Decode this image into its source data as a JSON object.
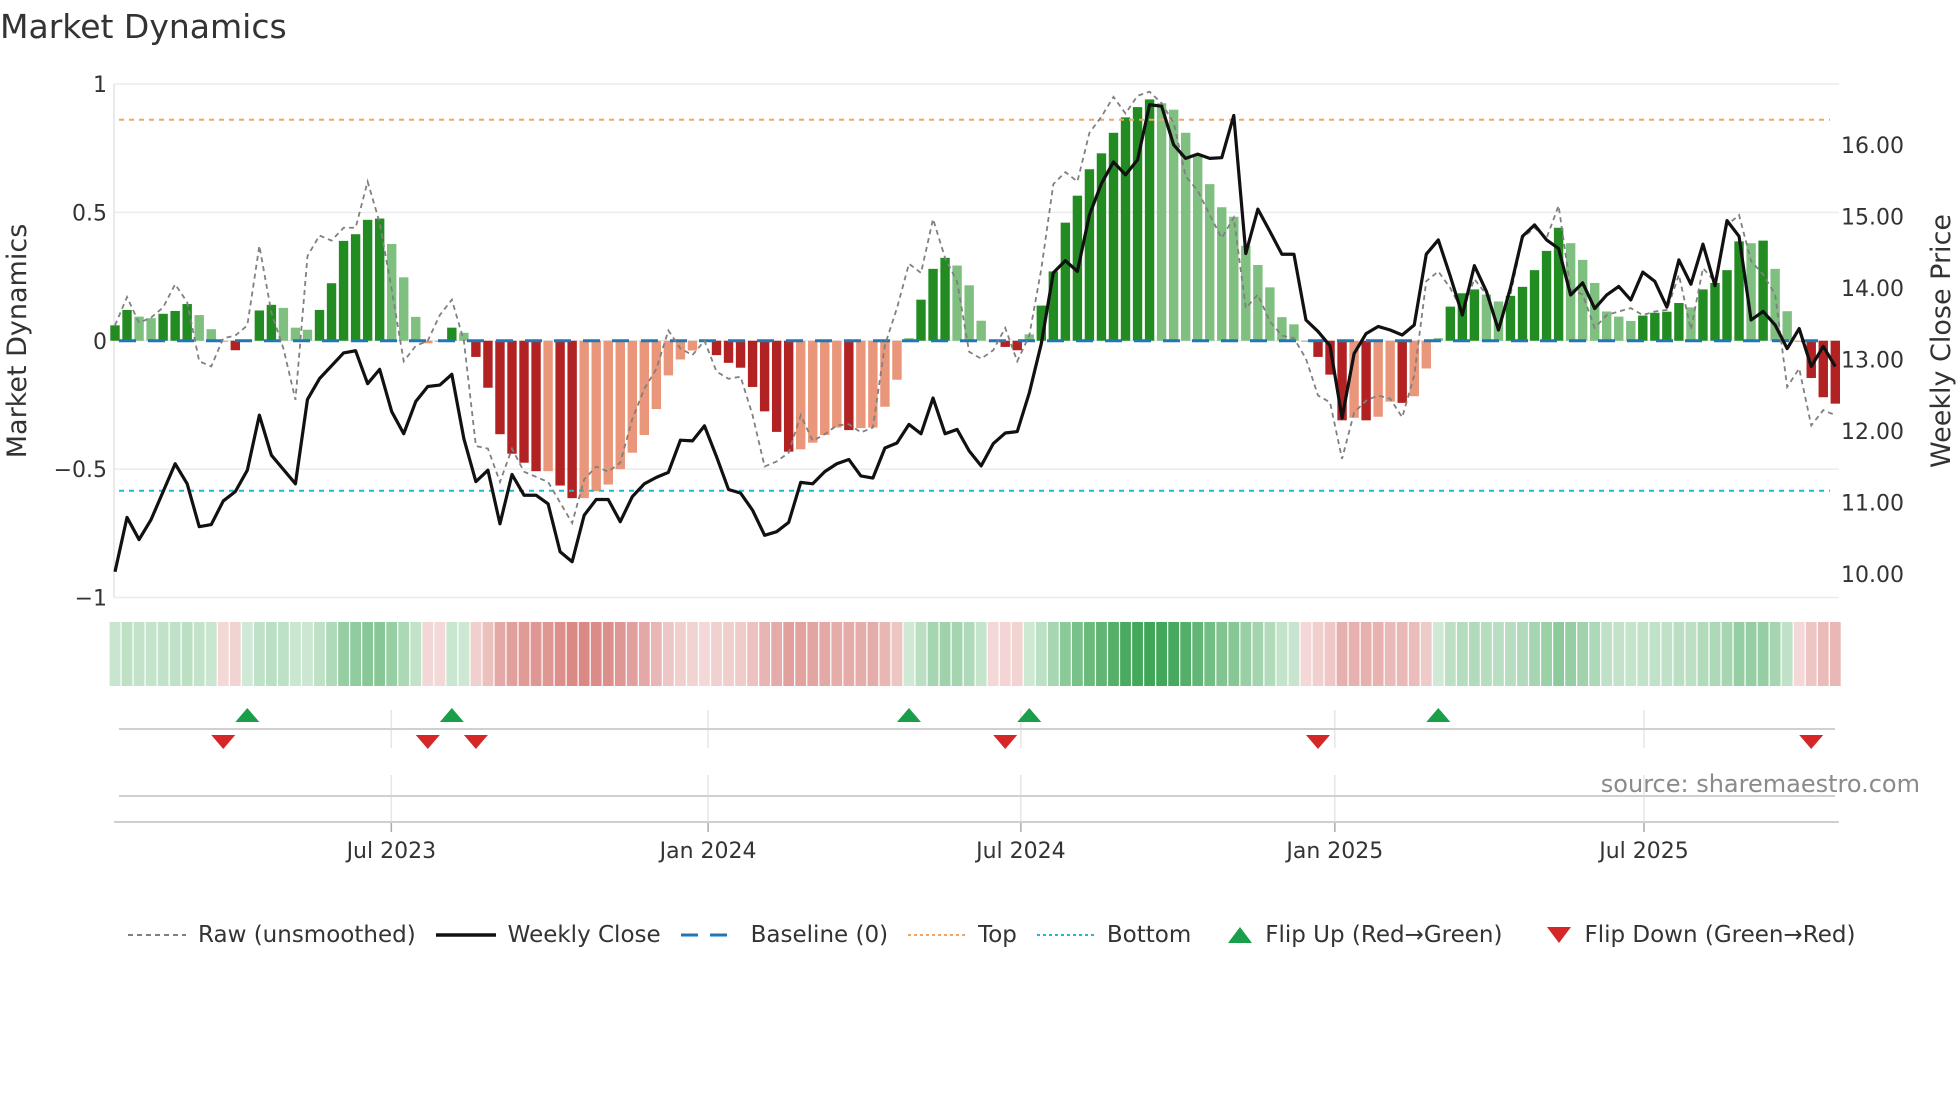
{
  "title": "Market Dynamics",
  "source": "source: sharemaestro.com",
  "colors": {
    "bar_up_strong": "#228b22",
    "bar_up_weak": "#7fbf7f",
    "bar_down_strong": "#b22222",
    "bar_down_weak": "#e9967a",
    "raw": "#808080",
    "close": "#111111",
    "baseline": "#1f77b4",
    "top": "#f4a460",
    "bottom": "#17becf",
    "flip_up": "#1a9e4a",
    "flip_down": "#d62728",
    "heat_pos": "#2e9e48",
    "heat_neg": "#c8504a"
  },
  "legend": [
    {
      "key": "raw",
      "label": "Raw (unsmoothed)"
    },
    {
      "key": "close",
      "label": "Weekly Close"
    },
    {
      "key": "baseline",
      "label": "Baseline (0)"
    },
    {
      "key": "top",
      "label": "Top"
    },
    {
      "key": "bottom",
      "label": "Bottom"
    },
    {
      "key": "flip_up",
      "label": "Flip Up (Red→Green)"
    },
    {
      "key": "flip_down",
      "label": "Flip Down (Green→Red)"
    }
  ],
  "chart_data": {
    "type": "bar",
    "title": "Market Dynamics",
    "ylabel": "Market Dynamics",
    "y2label": "Weekly Close Price",
    "ylim": [
      -1,
      1
    ],
    "y2lim": [
      9.67,
      16.85
    ],
    "yticks": [
      {
        "v": 1,
        "label": "1"
      },
      {
        "v": 0.5,
        "label": "0.5"
      },
      {
        "v": 0,
        "label": "0"
      },
      {
        "v": -0.5,
        "label": "−0.5"
      },
      {
        "v": -1,
        "label": "−1"
      }
    ],
    "y2ticks": [
      {
        "v": 16,
        "label": "16.00"
      },
      {
        "v": 15,
        "label": "15.00"
      },
      {
        "v": 14,
        "label": "14.00"
      },
      {
        "v": 13,
        "label": "13.00"
      },
      {
        "v": 12,
        "label": "12.00"
      },
      {
        "v": 11,
        "label": "11.00"
      },
      {
        "v": 10,
        "label": "10.00"
      }
    ],
    "xticks": [
      {
        "at": 22.97,
        "label": "Jul 2023"
      },
      {
        "at": 49.3,
        "label": "Jan 2024"
      },
      {
        "at": 75.3,
        "label": "Jul 2024"
      },
      {
        "at": 101.4,
        "label": "Jan 2025"
      },
      {
        "at": 127.1,
        "label": "Jul 2025"
      }
    ],
    "grid": true,
    "legend_position": "bottom",
    "top_level": 0.861,
    "bottom_level": -0.584,
    "baseline": 0,
    "oscillator": [
      0.06,
      0.12,
      0.094,
      0.088,
      0.105,
      0.116,
      0.143,
      0.1,
      0.045,
      -0.004,
      -0.037,
      0.004,
      0.118,
      0.14,
      0.128,
      0.051,
      0.043,
      0.12,
      0.224,
      0.389,
      0.415,
      0.471,
      0.476,
      0.377,
      0.247,
      0.093,
      -0.01,
      -0.004,
      0.051,
      0.031,
      -0.063,
      -0.183,
      -0.364,
      -0.44,
      -0.475,
      -0.508,
      -0.508,
      -0.564,
      -0.613,
      -0.613,
      -0.586,
      -0.56,
      -0.5,
      -0.436,
      -0.367,
      -0.266,
      -0.135,
      -0.073,
      -0.038,
      -0.004,
      -0.056,
      -0.086,
      -0.105,
      -0.18,
      -0.275,
      -0.355,
      -0.432,
      -0.423,
      -0.397,
      -0.367,
      -0.338,
      -0.348,
      -0.34,
      -0.338,
      -0.257,
      -0.152,
      0.01,
      0.16,
      0.28,
      0.323,
      0.293,
      0.216,
      0.078,
      -0.004,
      -0.024,
      -0.037,
      0.025,
      0.137,
      0.27,
      0.46,
      0.565,
      0.668,
      0.73,
      0.81,
      0.87,
      0.91,
      0.94,
      0.925,
      0.9,
      0.81,
      0.72,
      0.61,
      0.52,
      0.483,
      0.37,
      0.295,
      0.208,
      0.092,
      0.064,
      -0.004,
      -0.063,
      -0.132,
      -0.31,
      -0.3,
      -0.31,
      -0.296,
      -0.237,
      -0.242,
      -0.216,
      -0.108,
      0.01,
      0.133,
      0.185,
      0.2,
      0.18,
      0.153,
      0.175,
      0.21,
      0.275,
      0.35,
      0.44,
      0.38,
      0.315,
      0.225,
      0.114,
      0.094,
      0.077,
      0.098,
      0.109,
      0.113,
      0.147,
      0.13,
      0.2,
      0.225,
      0.275,
      0.387,
      0.38,
      0.39,
      0.28,
      0.115,
      -0.004,
      -0.145,
      -0.22,
      -0.245
    ],
    "raw": [
      0.06,
      0.17,
      0.07,
      0.09,
      0.13,
      0.22,
      0.15,
      -0.08,
      -0.1,
      0.01,
      0.02,
      0.06,
      0.37,
      0.11,
      -0.03,
      -0.23,
      0.33,
      0.41,
      0.39,
      0.44,
      0.44,
      0.62,
      0.46,
      0.2,
      -0.08,
      -0.02,
      0.0,
      0.1,
      0.16,
      0.0,
      -0.41,
      -0.42,
      -0.55,
      -0.42,
      -0.51,
      -0.53,
      -0.55,
      -0.63,
      -0.71,
      -0.54,
      -0.49,
      -0.51,
      -0.475,
      -0.305,
      -0.187,
      -0.11,
      0.04,
      -0.03,
      -0.056,
      0.0,
      -0.12,
      -0.148,
      -0.14,
      -0.29,
      -0.49,
      -0.47,
      -0.436,
      -0.29,
      -0.39,
      -0.364,
      -0.33,
      -0.325,
      -0.357,
      -0.338,
      -0.017,
      0.127,
      0.3,
      0.264,
      0.474,
      0.323,
      0.23,
      -0.043,
      -0.07,
      -0.037,
      0.05,
      -0.08,
      0.02,
      0.28,
      0.61,
      0.657,
      0.62,
      0.81,
      0.873,
      0.95,
      0.885,
      0.954,
      0.97,
      0.925,
      0.85,
      0.64,
      0.585,
      0.49,
      0.4,
      0.48,
      0.127,
      0.18,
      0.075,
      0.02,
      0.01,
      -0.07,
      -0.213,
      -0.24,
      -0.46,
      -0.28,
      -0.233,
      -0.213,
      -0.226,
      -0.298,
      -0.135,
      0.232,
      0.27,
      0.205,
      0.114,
      0.24,
      0.18,
      0.05,
      0.18,
      0.4,
      0.44,
      0.4,
      0.526,
      0.2,
      0.18,
      0.05,
      0.1,
      0.114,
      0.127,
      0.1,
      0.114,
      0.12,
      0.257,
      0.043,
      0.283,
      0.23,
      0.45,
      0.49,
      0.31,
      0.258,
      0.18,
      -0.18,
      -0.108,
      -0.33,
      -0.27,
      -0.29
    ],
    "weekly_close": [
      10.03,
      10.79,
      10.48,
      10.76,
      11.15,
      11.54,
      11.26,
      10.66,
      10.69,
      11.02,
      11.15,
      11.45,
      12.22,
      11.66,
      11.46,
      11.26,
      12.44,
      12.73,
      12.91,
      13.09,
      13.12,
      12.66,
      12.86,
      12.27,
      11.96,
      12.41,
      12.62,
      12.64,
      12.79,
      11.89,
      11.29,
      11.45,
      10.7,
      11.39,
      11.1,
      11.1,
      10.98,
      10.31,
      10.17,
      10.82,
      11.04,
      11.04,
      10.73,
      11.08,
      11.26,
      11.35,
      11.42,
      11.87,
      11.86,
      12.07,
      11.64,
      11.18,
      11.13,
      10.89,
      10.54,
      10.59,
      10.72,
      11.28,
      11.26,
      11.43,
      11.54,
      11.6,
      11.37,
      11.34,
      11.76,
      11.83,
      12.09,
      11.96,
      12.46,
      11.96,
      12.02,
      11.72,
      11.51,
      11.82,
      11.97,
      11.99,
      12.53,
      13.22,
      14.21,
      14.38,
      14.23,
      15.02,
      15.46,
      15.76,
      15.58,
      15.79,
      16.56,
      16.54,
      16.0,
      15.81,
      15.87,
      15.81,
      15.82,
      16.41,
      14.48,
      15.1,
      14.79,
      14.47,
      14.47,
      13.55,
      13.39,
      13.19,
      12.18,
      13.08,
      13.36,
      13.46,
      13.41,
      13.34,
      13.48,
      14.47,
      14.67,
      14.16,
      13.62,
      14.31,
      13.95,
      13.41,
      14.0,
      14.72,
      14.88,
      14.67,
      14.55,
      13.9,
      14.07,
      13.71,
      13.9,
      14.02,
      13.83,
      14.22,
      14.09,
      13.73,
      14.39,
      14.05,
      14.61,
      14.03,
      14.94,
      14.72,
      13.55,
      13.67,
      13.48,
      13.15,
      13.43,
      12.9,
      13.18,
      12.9
    ],
    "flip_up_at": [
      11,
      28,
      66,
      76,
      110
    ],
    "flip_down_at": [
      9,
      26,
      30,
      74,
      100,
      141
    ]
  }
}
